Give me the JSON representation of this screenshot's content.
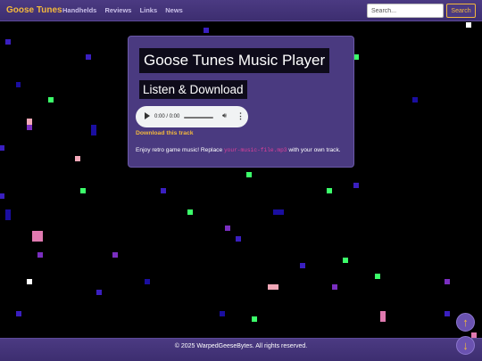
{
  "header": {
    "brand": "Goose Tunes",
    "nav": [
      "Handhelds",
      "Reviews",
      "Links",
      "News"
    ],
    "search_placeholder": "Search...",
    "search_button": "Search"
  },
  "player_card": {
    "title": "Goose Tunes Music Player",
    "subtitle": "Listen & Download",
    "audio": {
      "time": "0:00 / 0:00",
      "progress": 0
    },
    "download_link": "Download this track",
    "description_before": "Enjoy retro game music! Replace ",
    "description_code": "your-music-file.mp3",
    "description_after": " with your own track."
  },
  "footer": {
    "text": "© 2025 WarpedGeeseBytes. All rights reserved."
  },
  "scroll_buttons": {
    "up": "↑",
    "down": "↓"
  },
  "colors": {
    "accent": "#f3b83c",
    "header_bg": "#4b3a82",
    "card_bg": "#4a3a80",
    "code": "#e0409a",
    "background": "#000000"
  }
}
